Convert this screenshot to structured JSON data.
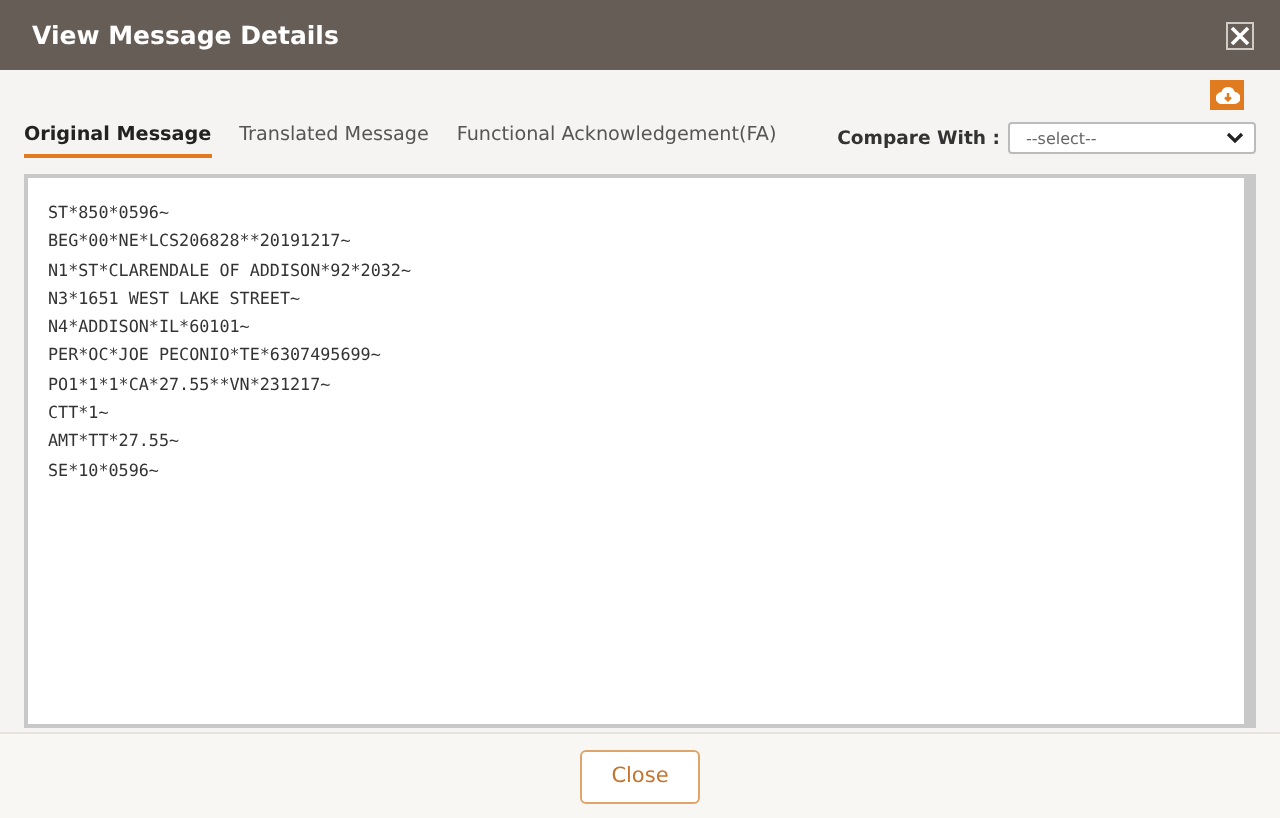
{
  "window": {
    "title": "View Message Details"
  },
  "tabs": [
    {
      "label": "Original Message",
      "selected": true
    },
    {
      "label": "Translated Message",
      "selected": false
    },
    {
      "label": "Functional Acknowledgement(FA)",
      "selected": false
    }
  ],
  "compare": {
    "label": "Compare With :",
    "value": "--select--"
  },
  "message_lines": [
    "ST*850*0596~",
    "BEG*00*NE*LCS206828**20191217~",
    "N1*ST*CLARENDALE OF ADDISON*92*2032~",
    "N3*1651 WEST LAKE STREET~",
    "N4*ADDISON*IL*60101~",
    "PER*OC*JOE PECONIO*TE*6307495699~",
    "PO1*1*1*CA*27.55**VN*231217~",
    "CTT*1~",
    "AMT*TT*27.55~",
    "SE*10*0596~"
  ],
  "buttons": [
    "Close"
  ]
}
